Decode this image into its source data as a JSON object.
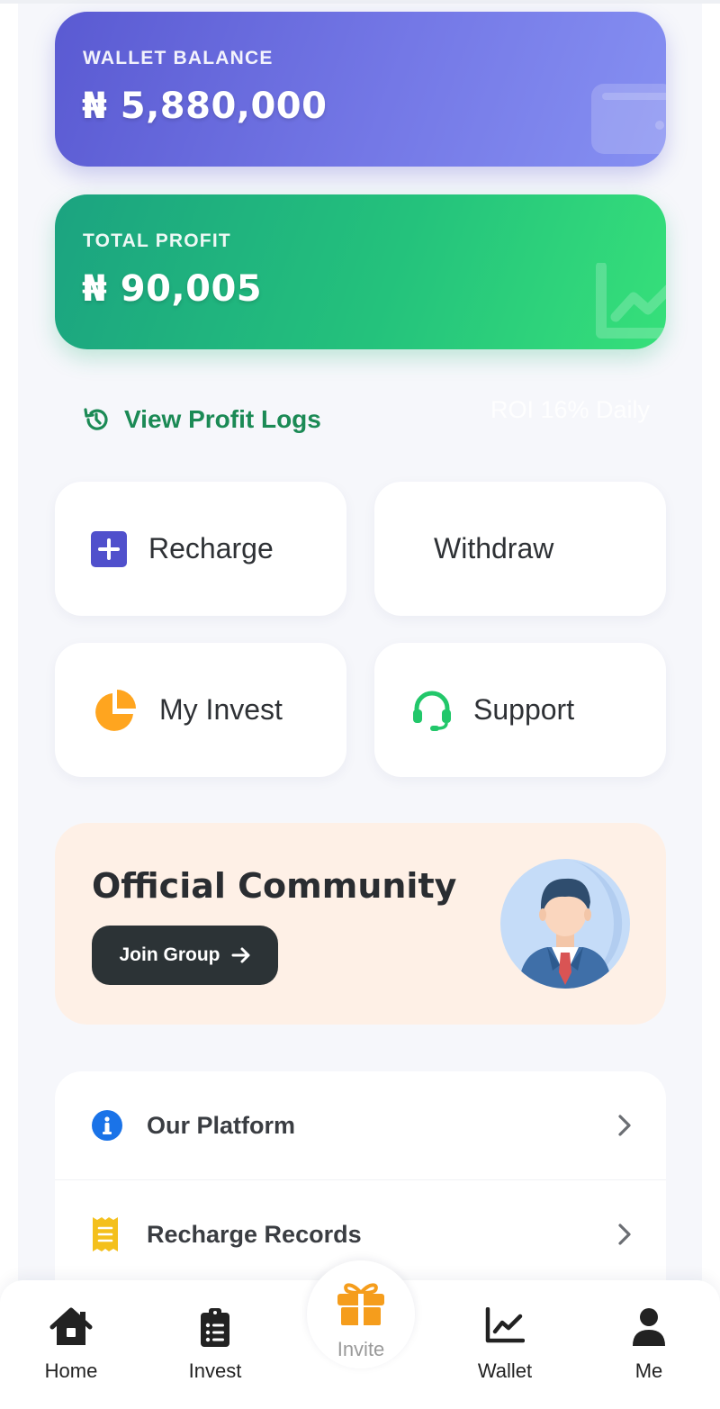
{
  "wallet": {
    "label": "WALLET BALANCE",
    "amount": "₦ 5,880,000"
  },
  "profit": {
    "label": "TOTAL PROFIT",
    "amount": "₦ 90,005"
  },
  "logs": {
    "link_label": "View Profit Logs",
    "roi_text": "ROI 16% Daily"
  },
  "actions": [
    {
      "label": "Recharge",
      "icon": "plus-square-icon"
    },
    {
      "label": "Withdraw",
      "icon": ""
    },
    {
      "label": "My Invest",
      "icon": "pie-chart-icon"
    },
    {
      "label": "Support",
      "icon": "headset-icon"
    }
  ],
  "community": {
    "title": "Official Community",
    "button_label": "Join Group",
    "avatar": "businessman-avatar"
  },
  "menu": [
    {
      "label": "Our Platform",
      "icon": "info-icon"
    },
    {
      "label": "Recharge Records",
      "icon": "receipt-icon"
    }
  ],
  "nav": [
    {
      "label": "Home",
      "icon": "home-icon"
    },
    {
      "label": "Invest",
      "icon": "clipboard-icon"
    },
    {
      "label": "Invite",
      "icon": "gift-icon"
    },
    {
      "label": "Wallet",
      "icon": "chart-line-icon"
    },
    {
      "label": "Me",
      "icon": "user-icon"
    }
  ],
  "colors": {
    "wallet_gradient": [
      "#5a5ad2",
      "#8690f2"
    ],
    "profit_gradient": [
      "#1ba380",
      "#36e07a"
    ],
    "link_green": "#1b8a55",
    "recharge_icon": "#5050cc",
    "invest_icon": "#ffa51f",
    "support_icon": "#22c76a",
    "info_icon": "#1a73e8",
    "receipt_icon": "#f4c01c",
    "invite_icon": "#f59d1c",
    "community_bg": "#fef0e6",
    "join_btn": "#2c3336"
  }
}
